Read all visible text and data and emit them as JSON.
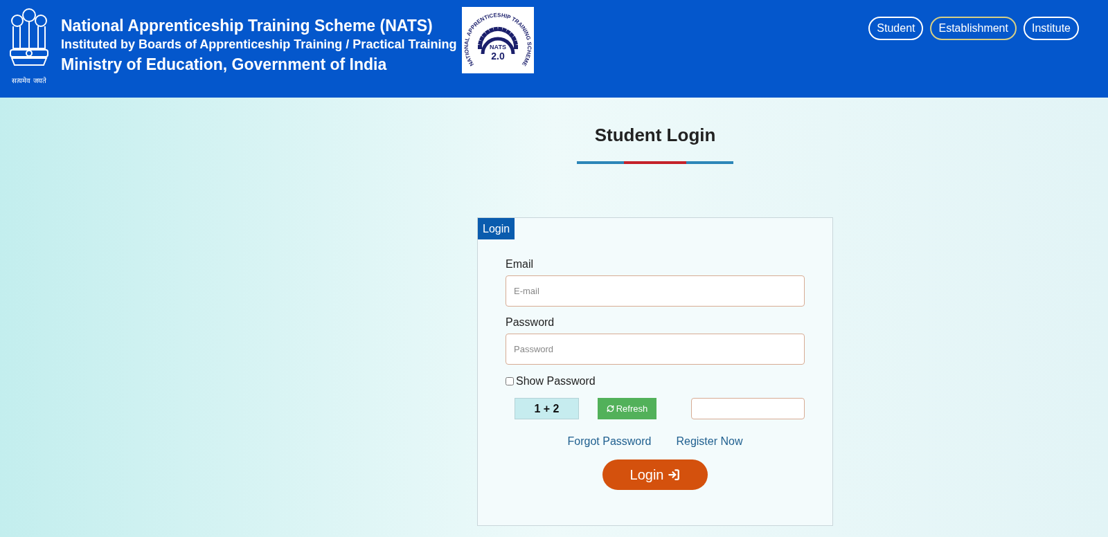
{
  "header": {
    "emblem_motto": "सत्यमेव जयते",
    "title": "National Apprenticeship Training Scheme (NATS)",
    "subtitle": "Instituted by Boards of Apprenticeship Training / Practical Training",
    "ministry": "Ministry of Education, Government of India",
    "logo": {
      "arc_text": "NATIONAL APPRENTICESHIP TRAINING SCHEME",
      "name": "NATS",
      "version": "2.0"
    },
    "nav": [
      {
        "label": "Student",
        "selected": false
      },
      {
        "label": "Establishment",
        "selected": true
      },
      {
        "label": "Institute",
        "selected": false
      }
    ]
  },
  "page_title": "Student Login",
  "card": {
    "legend": "Login",
    "fields": [
      {
        "label": "Email",
        "placeholder": "E-mail"
      },
      {
        "label": "Password",
        "placeholder": "Password"
      }
    ],
    "show_password": {
      "label": "Show Password",
      "checked": false
    },
    "captcha": {
      "question": "1 + 2",
      "refresh": "Refresh"
    },
    "links": [
      "Forgot Password",
      "Register Now"
    ],
    "submit": "Login"
  }
}
